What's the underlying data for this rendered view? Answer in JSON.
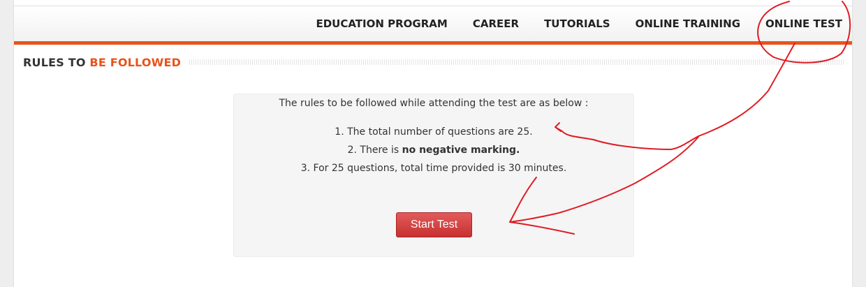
{
  "nav": {
    "items": [
      {
        "label": "EDUCATION PROGRAM"
      },
      {
        "label": "CAREER"
      },
      {
        "label": "TUTORIALS"
      },
      {
        "label": "ONLINE TRAINING"
      },
      {
        "label": "ONLINE TEST"
      }
    ]
  },
  "section": {
    "title_plain": "RULES TO ",
    "title_accent": "BE FOLLOWED"
  },
  "rules": {
    "intro": "The rules to be followed while attending the test are as below :",
    "items": [
      {
        "text": "1. The total number of questions are 25."
      },
      {
        "prefix": "2. There is ",
        "bold": "no negative marking."
      },
      {
        "text": "3. For 25 questions, total time provided is 30 minutes."
      }
    ]
  },
  "button": {
    "label": "Start Test"
  },
  "colors": {
    "accent": "#e8531b",
    "button": "#d13f3f",
    "annotation": "#e01b24"
  }
}
